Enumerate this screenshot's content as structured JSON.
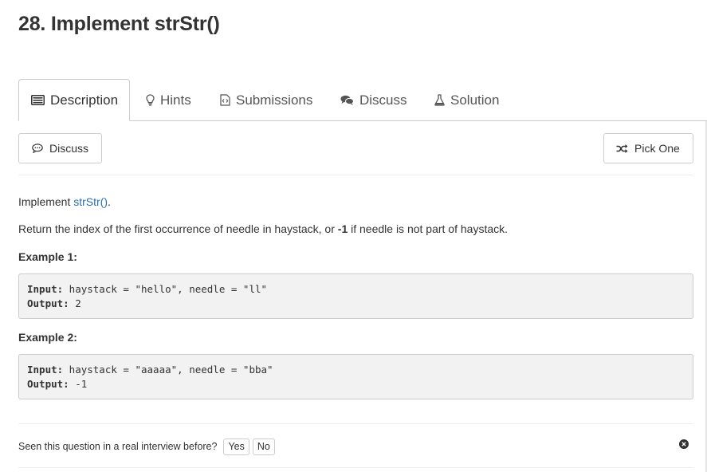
{
  "page": {
    "title": "28. Implement strStr()"
  },
  "tabs": [
    {
      "label": "Description",
      "icon": "description-icon",
      "active": true
    },
    {
      "label": "Hints",
      "icon": "lightbulb-icon"
    },
    {
      "label": "Submissions",
      "icon": "code-file-icon"
    },
    {
      "label": "Discuss",
      "icon": "chat-bubbles-icon"
    },
    {
      "label": "Solution",
      "icon": "flask-icon"
    }
  ],
  "toolbar": {
    "discuss_label": "Discuss",
    "pick_one_label": "Pick One"
  },
  "description": {
    "intro_prefix": "Implement ",
    "intro_link": "strStr()",
    "intro_suffix": ".",
    "return_prefix": "Return the index of the first occurrence of needle in haystack, or ",
    "return_bold": "-1",
    "return_suffix": " if needle is not part of haystack."
  },
  "examples": [
    {
      "heading": "Example 1:",
      "input_label": "Input:",
      "input_value": " haystack = \"hello\", needle = \"ll\"",
      "output_label": "Output:",
      "output_value": " 2"
    },
    {
      "heading": "Example 2:",
      "input_label": "Input:",
      "input_value": " haystack = \"aaaaa\", needle = \"bba\"",
      "output_label": "Output:",
      "output_value": " -1"
    }
  ],
  "footer": {
    "question": "Seen this question in a real interview before?",
    "yes_label": "Yes",
    "no_label": "No"
  },
  "colors": {
    "link": "#2a6fb0",
    "border": "#cccccc",
    "code_bg": "#f2f2f2"
  }
}
